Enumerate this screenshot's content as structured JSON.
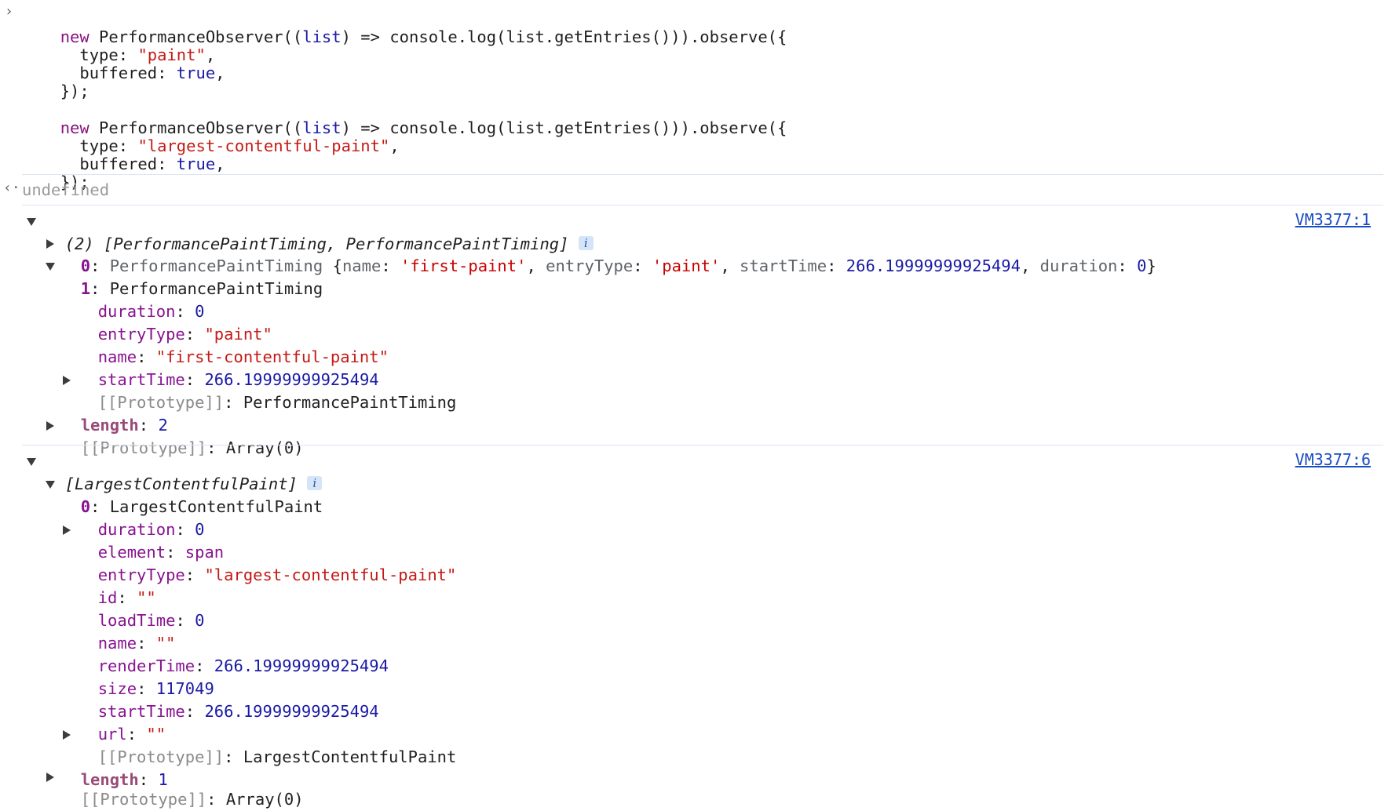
{
  "input": {
    "lines": [
      {
        "a": "new",
        "b": " PerformanceObserver((",
        "c": "list",
        "d": ") => console.log(list.getEntries())).observe({"
      },
      {
        "a": "  type: ",
        "b": "\"paint\"",
        "c": ","
      },
      {
        "a": "  buffered: ",
        "b": "true",
        "c": ","
      },
      {
        "a": "});"
      },
      {
        "a": "new",
        "b": " PerformanceObserver((",
        "c": "list",
        "d": ") => console.log(list.getEntries())).observe({"
      },
      {
        "a": "  type: ",
        "b": "\"largest-contentful-paint\"",
        "c": ","
      },
      {
        "a": "  buffered: ",
        "b": "true",
        "c": ","
      },
      {
        "a": "});"
      }
    ]
  },
  "result": {
    "undefined_text": "undefined"
  },
  "entry1": {
    "summary": "(2) [PerformancePaintTiming, PerformancePaintTiming]",
    "info": "i",
    "source": "VM3377:1",
    "item0": {
      "index": "0",
      "class": "PerformancePaintTiming",
      "open": " {",
      "k1": "name",
      "v1": "'first-paint'",
      "k2": "entryType",
      "v2": "'paint'",
      "k3": "startTime",
      "v3": "266.19999999925494",
      "k4": "duration",
      "v4": "0",
      "close": "}"
    },
    "item1": {
      "index": "1",
      "class": "PerformancePaintTiming",
      "duration_key": "duration",
      "duration_val": "0",
      "entryType_key": "entryType",
      "entryType_val": "\"paint\"",
      "name_key": "name",
      "name_val": "\"first-contentful-paint\"",
      "startTime_key": "startTime",
      "startTime_val": "266.19999999925494",
      "proto_key": "[[Prototype]]",
      "proto_val": "PerformancePaintTiming"
    },
    "length_key": "length",
    "length_val": "2",
    "proto_key": "[[Prototype]]",
    "proto_val": "Array(0)"
  },
  "entry2": {
    "summary": "[LargestContentfulPaint]",
    "info": "i",
    "source": "VM3377:6",
    "item0": {
      "index": "0",
      "class": "LargestContentfulPaint",
      "duration_key": "duration",
      "duration_val": "0",
      "element_key": "element",
      "element_val": "span",
      "entryType_key": "entryType",
      "entryType_val": "\"largest-contentful-paint\"",
      "id_key": "id",
      "id_val": "\"\"",
      "loadTime_key": "loadTime",
      "loadTime_val": "0",
      "name_key": "name",
      "name_val": "\"\"",
      "renderTime_key": "renderTime",
      "renderTime_val": "266.19999999925494",
      "size_key": "size",
      "size_val": "117049",
      "startTime_key": "startTime",
      "startTime_val": "266.19999999925494",
      "url_key": "url",
      "url_val": "\"\"",
      "proto_key": "[[Prototype]]",
      "proto_val": "LargestContentfulPaint"
    },
    "length_key": "length",
    "length_val": "1",
    "proto_key": "[[Prototype]]",
    "proto_val": "Array(0)"
  },
  "colors": {
    "keyword": "#881280",
    "string": "#c41a16",
    "number": "#1a1aa6",
    "property": "#881391",
    "link": "#1a4dc2",
    "divider": "#dde6f2"
  }
}
